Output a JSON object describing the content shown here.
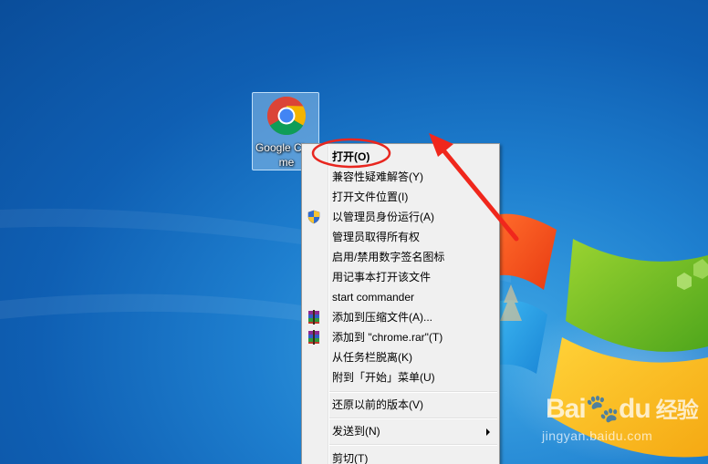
{
  "desktop": {
    "icon": {
      "label": "Google Chrome",
      "icon_name": "chrome-icon"
    }
  },
  "context_menu": {
    "items": [
      {
        "label": "打开(O)",
        "bold": true
      },
      {
        "label": "兼容性疑难解答(Y)"
      },
      {
        "label": "打开文件位置(I)"
      },
      {
        "label": "以管理员身份运行(A)",
        "icon": "uac-shield-icon"
      },
      {
        "label": "管理员取得所有权"
      },
      {
        "label": "启用/禁用数字签名图标"
      },
      {
        "label": "用记事本打开该文件"
      },
      {
        "label": "start commander"
      },
      {
        "label": "添加到压缩文件(A)...",
        "icon": "winrar-icon"
      },
      {
        "label": "添加到 \"chrome.rar\"(T)",
        "icon": "winrar-icon"
      },
      {
        "label": "从任务栏脱离(K)"
      },
      {
        "label": "附到「开始」菜单(U)"
      },
      {
        "label": "还原以前的版本(V)"
      },
      {
        "label": "发送到(N)",
        "submenu": true
      },
      {
        "label": "剪切(T)"
      }
    ]
  },
  "annotations": {
    "highlight_color": "#e8261f",
    "arrow_color": "#f0271c"
  },
  "watermark": {
    "logo": "Bai",
    "logo_tail": "du",
    "logo_cn": "经验",
    "url": "jingyan.baidu.com"
  },
  "colors": {
    "desktop": "#1e7fcf",
    "menu_bg": "#f0f0f0"
  }
}
